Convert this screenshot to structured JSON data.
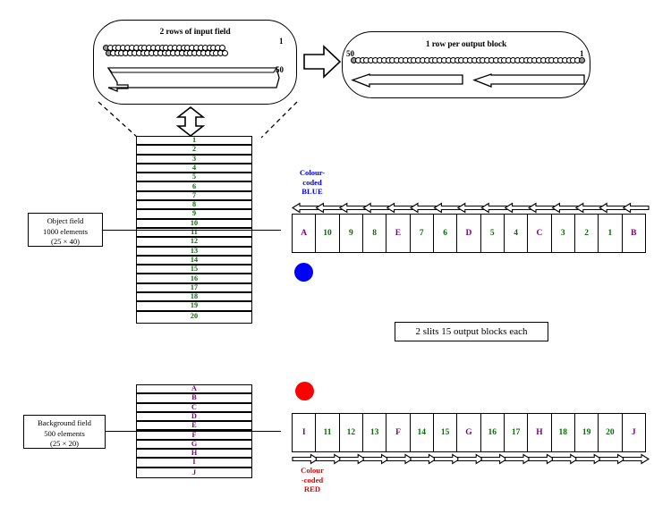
{
  "input_callout": {
    "title": "2 rows of input field",
    "top_index": "1",
    "bottom_index": "50",
    "circles_per_row": 28,
    "rows": 2
  },
  "output_callout": {
    "title": "1 row per output block",
    "left_index": "50",
    "right_index": "1",
    "circles": 54,
    "rows": 1
  },
  "object_field": {
    "caption_line1": "Object field",
    "caption_line2": "1000 elements",
    "caption_line3": "(25 × 40)",
    "rows": [
      "1",
      "2",
      "3",
      "4",
      "5",
      "6",
      "7",
      "8",
      "9",
      "10",
      "11",
      "12",
      "13",
      "14",
      "15",
      "16",
      "17",
      "18",
      "19",
      "20"
    ],
    "row_color": "#007000"
  },
  "background_field": {
    "caption_line1": "Background field",
    "caption_line2": "500 elements",
    "caption_line3": "(25 × 20)",
    "rows": [
      "A",
      "B",
      "C",
      "D",
      "E",
      "F",
      "G",
      "H",
      "I",
      "J"
    ],
    "row_color": "#800080"
  },
  "slits_caption": "2 slits  15 output blocks each",
  "blue_block": {
    "label_line1": "Colour-",
    "label_line2": "coded",
    "label_line3": "BLUE",
    "label_color": "#0000ee",
    "dot_color": "#0000ff",
    "arrow_direction": "left",
    "cells": [
      {
        "text": "A",
        "kind": "ltr"
      },
      {
        "text": "10",
        "kind": "num"
      },
      {
        "text": "9",
        "kind": "num"
      },
      {
        "text": "8",
        "kind": "num"
      },
      {
        "text": "E",
        "kind": "ltr"
      },
      {
        "text": "7",
        "kind": "num"
      },
      {
        "text": "6",
        "kind": "num"
      },
      {
        "text": "D",
        "kind": "ltr"
      },
      {
        "text": "5",
        "kind": "num"
      },
      {
        "text": "4",
        "kind": "num"
      },
      {
        "text": "C",
        "kind": "ltr"
      },
      {
        "text": "3",
        "kind": "num"
      },
      {
        "text": "2",
        "kind": "num"
      },
      {
        "text": "1",
        "kind": "num"
      },
      {
        "text": "B",
        "kind": "ltr"
      }
    ]
  },
  "red_block": {
    "label_line1": "Colour",
    "label_line2": "-coded",
    "label_line3": "RED",
    "label_color": "#ee0000",
    "dot_color": "#ff0000",
    "arrow_direction": "right",
    "cells": [
      {
        "text": "I",
        "kind": "ltr"
      },
      {
        "text": "11",
        "kind": "num"
      },
      {
        "text": "12",
        "kind": "num"
      },
      {
        "text": "13",
        "kind": "num"
      },
      {
        "text": "F",
        "kind": "ltr"
      },
      {
        "text": "14",
        "kind": "num"
      },
      {
        "text": "15",
        "kind": "num"
      },
      {
        "text": "G",
        "kind": "ltr"
      },
      {
        "text": "16",
        "kind": "num"
      },
      {
        "text": "17",
        "kind": "num"
      },
      {
        "text": "H",
        "kind": "ltr"
      },
      {
        "text": "18",
        "kind": "num"
      },
      {
        "text": "19",
        "kind": "num"
      },
      {
        "text": "20",
        "kind": "num"
      },
      {
        "text": "J",
        "kind": "ltr"
      }
    ]
  }
}
